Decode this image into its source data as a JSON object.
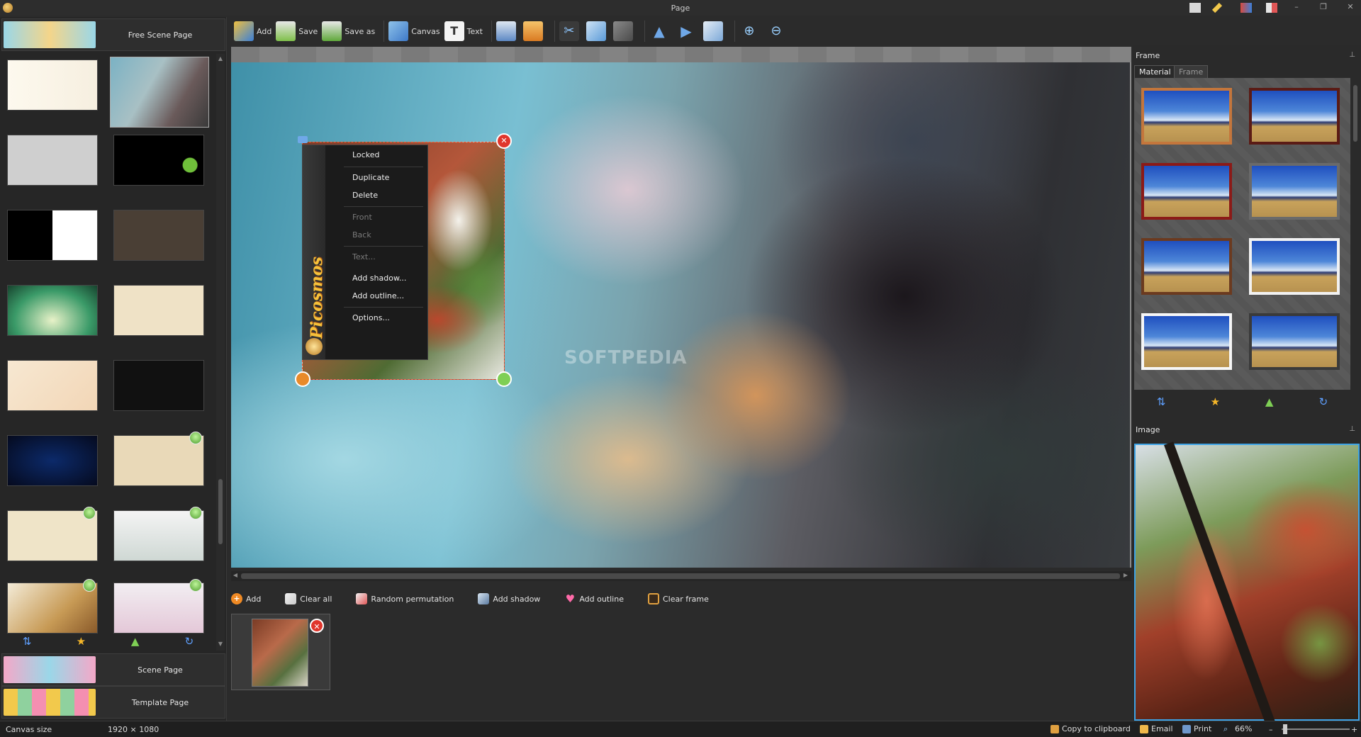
{
  "window": {
    "title": "Page"
  },
  "toolbar": {
    "add": "Add",
    "save": "Save",
    "save_as": "Save as",
    "canvas": "Canvas",
    "text": "Text"
  },
  "left_panel": {
    "free_scene_page": "Free Scene Page",
    "scene_page": "Scene Page",
    "template_page": "Template Page"
  },
  "context_menu": {
    "locked": "Locked",
    "duplicate": "Duplicate",
    "delete": "Delete",
    "front": "Front",
    "back": "Back",
    "text": "Text...",
    "add_shadow": "Add shadow...",
    "add_outline": "Add outline...",
    "options": "Options..."
  },
  "brand": "Picosmos",
  "watermark": "SOFTPEDIA",
  "action_bar": {
    "add": "Add",
    "clear_all": "Clear all",
    "random_permutation": "Random permutation",
    "add_shadow": "Add shadow",
    "add_outline": "Add outline",
    "clear_frame": "Clear frame"
  },
  "right_panel": {
    "frame_title": "Frame",
    "tab_material": "Material",
    "tab_frame": "Frame",
    "image_title": "Image"
  },
  "status": {
    "canvas_size_label": "Canvas size",
    "canvas_size_value": "1920 × 1080",
    "copy_to_clipboard": "Copy to clipboard",
    "email": "Email",
    "print": "Print",
    "zoom": "66%",
    "zoom_minus": "–",
    "zoom_plus": "+"
  },
  "colors": {
    "accent": "#3da3e6",
    "selection": "#ff5a3c",
    "delete_badge": "#e0362c"
  }
}
